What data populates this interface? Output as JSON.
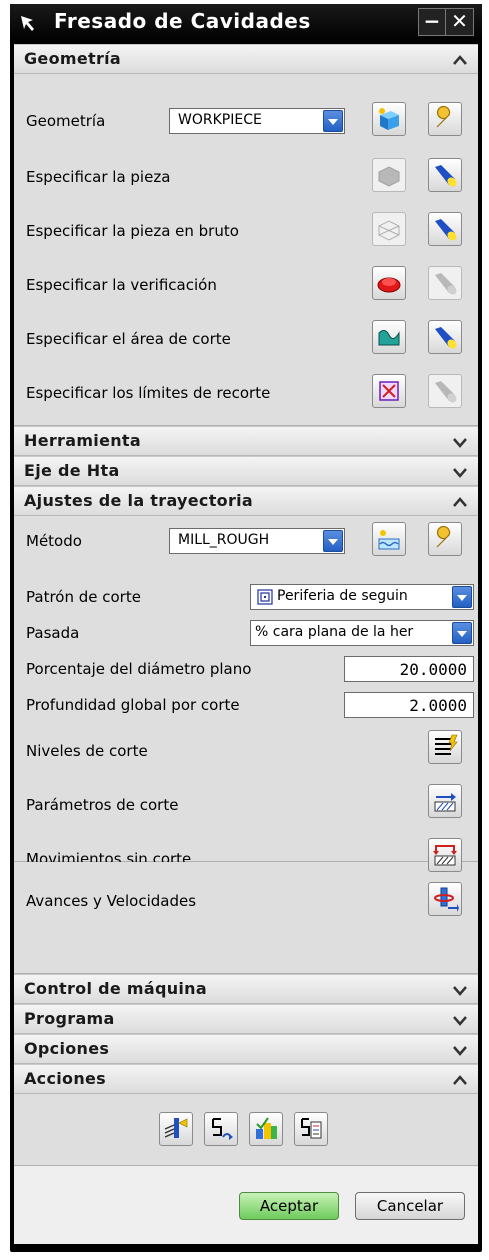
{
  "window": {
    "title": "Fresado de Cavidades"
  },
  "sections": {
    "geometria": {
      "title": "Geometría",
      "state": "expanded"
    },
    "herramienta": {
      "title": "Herramienta",
      "state": "collapsed"
    },
    "eje": {
      "title": "Eje de Hta",
      "state": "collapsed"
    },
    "ajustes": {
      "title": "Ajustes de la trayectoria",
      "state": "expanded"
    },
    "control": {
      "title": "Control de máquina",
      "state": "collapsed"
    },
    "programa": {
      "title": "Programa",
      "state": "collapsed"
    },
    "opciones": {
      "title": "Opciones",
      "state": "collapsed"
    },
    "acciones": {
      "title": "Acciones",
      "state": "expanded"
    }
  },
  "geometry": {
    "geometry_label": "Geometría",
    "geometry_value": "WORKPIECE",
    "rows": [
      "Especificar la pieza",
      "Especificar la pieza en bruto",
      "Especificar la verificación",
      "Especificar el área de corte",
      "Especificar los límites de recorte"
    ]
  },
  "path_settings": {
    "method_label": "Método",
    "method_value": "MILL_ROUGH",
    "pattern_label": "Patrón de corte",
    "pattern_value": "Periferia de seguin",
    "stepover_label": "Pasada",
    "stepover_value": "% cara plana de la her",
    "percent_label": "Porcentaje del diámetro plano",
    "percent_value": "20.0000",
    "depth_label": "Profundidad global por corte",
    "depth_value": "2.0000",
    "levels_label": "Niveles de corte",
    "params_label": "Parámetros de corte",
    "noncut_label": "Movimientos sin corte",
    "feeds_label": "Avances y Velocidades"
  },
  "footer": {
    "ok_label": "Aceptar",
    "cancel_label": "Cancelar"
  },
  "colors": {
    "accent_blue": "#2360c4",
    "ok_green": "#6ecb5b",
    "panel_bg": "#dedede"
  }
}
